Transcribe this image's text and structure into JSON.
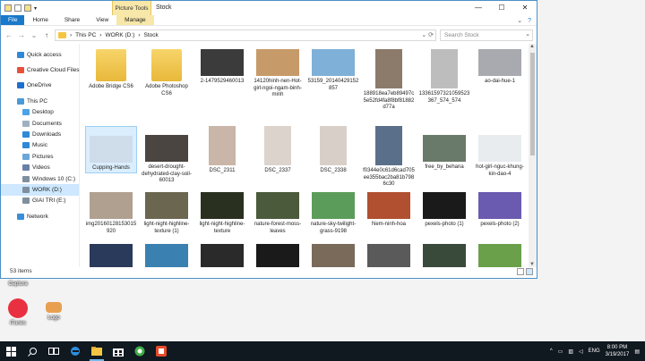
{
  "window": {
    "title": "Stock",
    "context_tab": "Picture Tools",
    "minimize": "—",
    "maximize": "☐",
    "close": "✕"
  },
  "ribbon": {
    "tabs": [
      "File",
      "Home",
      "Share",
      "View",
      "Manage"
    ],
    "expand_icon": "chevron-down-icon",
    "help_icon": "help-icon"
  },
  "address": {
    "back": "←",
    "forward": "→",
    "recent": "⌄",
    "up": "↑",
    "path": [
      "This PC",
      "WORK (D:)",
      "Stock"
    ],
    "search_placeholder": "Search Stock"
  },
  "nav": [
    {
      "label": "Quick access",
      "icon": "star-icon",
      "color": "#2f88d8"
    },
    {
      "label": "Creative Cloud Files",
      "icon": "cloud-icon",
      "color": "#e8503a"
    },
    {
      "label": "OneDrive",
      "icon": "onedrive-icon",
      "color": "#1e6fd0"
    },
    {
      "label": "This PC",
      "icon": "pc-icon",
      "color": "#4a9ad8"
    },
    {
      "label": "Desktop",
      "icon": "desktop-icon",
      "color": "#4aa3e8"
    },
    {
      "label": "Documents",
      "icon": "documents-icon",
      "color": "#9fb0c2"
    },
    {
      "label": "Downloads",
      "icon": "downloads-icon",
      "color": "#2f88d8"
    },
    {
      "label": "Music",
      "icon": "music-icon",
      "color": "#2f88d8"
    },
    {
      "label": "Pictures",
      "icon": "pictures-icon",
      "color": "#6aa6d8"
    },
    {
      "label": "Videos",
      "icon": "videos-icon",
      "color": "#6a7fa8"
    },
    {
      "label": "Windows 10 (C:)",
      "icon": "drive-icon",
      "color": "#7f8f9f"
    },
    {
      "label": "WORK (D:)",
      "icon": "drive-icon",
      "color": "#7f8f9f"
    },
    {
      "label": "GIAI TRI (E:)",
      "icon": "drive-icon",
      "color": "#7f8f9f"
    },
    {
      "label": "Network",
      "icon": "network-icon",
      "color": "#3a8ed8"
    }
  ],
  "files": [
    {
      "name": "Adobe Bridge CS6",
      "kind": "folder"
    },
    {
      "name": "Adobe Photoshop CS6",
      "kind": "folder"
    },
    {
      "name": "2-1479529460013",
      "kind": "image",
      "color": "#3b3b3b"
    },
    {
      "name": "14120hinh-nen-Hot-girl-ngoi-ngam-binh-minh",
      "kind": "image",
      "color": "#c79a6a"
    },
    {
      "name": "53159_20140429152857",
      "kind": "image",
      "color": "#7fb0d8"
    },
    {
      "name": "188918ea7eb89497c5e52fd4fa8f8bf81882d77a",
      "kind": "image",
      "color": "#8c7a6a"
    },
    {
      "name": "13361597321059523367_574_574",
      "kind": "image",
      "color": "#bdbdbd"
    },
    {
      "name": "ao-dai-hue-1",
      "kind": "image",
      "color": "#a8aab0"
    },
    {
      "name": "Cupping-Hands",
      "kind": "image",
      "color": "#cfdcea"
    },
    {
      "name": "desert-drought-dehydrated-clay-soil-60013",
      "kind": "image",
      "color": "#4a4540"
    },
    {
      "name": "DSC_2311",
      "kind": "image",
      "color": "#c9b6a8"
    },
    {
      "name": "DSC_2337",
      "kind": "image",
      "color": "#dcd3cc"
    },
    {
      "name": "DSC_2338",
      "kind": "image",
      "color": "#d8d0c8"
    },
    {
      "name": "f0344e0c61d6cad705ee355bac2ba81b7986c30",
      "kind": "image",
      "color": "#5a6f8a"
    },
    {
      "name": "free_by_behana",
      "kind": "image",
      "color": "#6a7a6a"
    },
    {
      "name": "hot-girl-nguc-khung-kin-dao-4",
      "kind": "image",
      "color": "#e8ecef"
    },
    {
      "name": "img20160128153015920",
      "kind": "image",
      "color": "#b0a090"
    },
    {
      "name": "light-night-highline-texture (1)",
      "kind": "image",
      "color": "#6a6650"
    },
    {
      "name": "light-night-highline-texture",
      "kind": "image",
      "color": "#2a3020"
    },
    {
      "name": "nature-forest-moss-leaves",
      "kind": "image",
      "color": "#4a5a3a"
    },
    {
      "name": "nature-sky-twilight-grass-9198",
      "kind": "image",
      "color": "#5c9c5a"
    },
    {
      "name": "Nem-ninh-hoa",
      "kind": "image",
      "color": "#b05030"
    },
    {
      "name": "pexels-photo (1)",
      "kind": "image",
      "color": "#1a1a1a"
    },
    {
      "name": "pexels-photo (2)",
      "kind": "image",
      "color": "#6a5ab0"
    },
    {
      "name": "",
      "kind": "image",
      "color": "#2a3a5a"
    },
    {
      "name": "",
      "kind": "image",
      "color": "#3a80b0"
    },
    {
      "name": "",
      "kind": "image",
      "color": "#2a2a2a"
    },
    {
      "name": "",
      "kind": "image",
      "color": "#1a1a1a"
    },
    {
      "name": "",
      "kind": "image",
      "color": "#7a6a5a"
    },
    {
      "name": "",
      "kind": "image",
      "color": "#5a5a5a"
    },
    {
      "name": "",
      "kind": "image",
      "color": "#3a4a3a"
    },
    {
      "name": "",
      "kind": "image",
      "color": "#6aa04a"
    }
  ],
  "status": {
    "count": "53 items"
  },
  "desktop_icons": [
    {
      "label": "Captura",
      "color": "#e0e0e0"
    },
    {
      "label": "iTunes",
      "color": "#e83040"
    },
    {
      "label": "Logo",
      "color": "#e8a050"
    }
  ],
  "taskbar": {
    "lang": "ENG",
    "time": "8:00 PM",
    "date": "3/19/2017",
    "apps": [
      "start-icon",
      "search-icon",
      "task-view-icon",
      "edge-icon",
      "file-explorer-icon",
      "store-icon",
      "camtasia-icon",
      "snagit-icon"
    ]
  }
}
